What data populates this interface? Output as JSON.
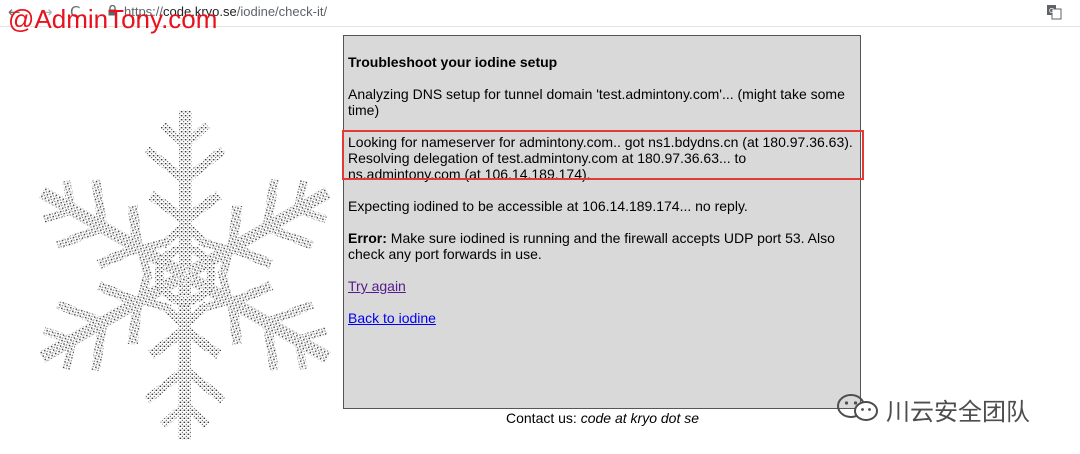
{
  "browser": {
    "back_icon": "←",
    "forward_icon": "→",
    "reload_icon": "C",
    "url_scheme": "https://",
    "url_host": "code.kryo.se",
    "url_path": "/iodine/check-it/"
  },
  "watermark": {
    "top_text": "@AdminTony.com",
    "wechat_text": "川云安全团队",
    "accent": "#e8111d"
  },
  "panel": {
    "title": "Troubleshoot your iodine setup",
    "analyzing": "Analyzing DNS setup for tunnel domain 'test.admintony.com'... (might take some time)",
    "lookup": "Looking for nameserver for admintony.com.. got ns1.bdydns.cn (at 180.97.36.63). Resolving delegation of test.admintony.com at 180.97.36.63... to ns.admintony.com (at 106.14.189.174).",
    "expecting": "Expecting iodined to be accessible at 106.14.189.174... no reply.",
    "error_label": "Error:",
    "error_text": " Make sure iodined is running and the firewall accepts UDP port 53. Also check any port forwards in use.",
    "try_again": "Try again",
    "back_link": "Back to iodine"
  },
  "footer": {
    "contact_label": "Contact us:",
    "contact_value": "code at kryo dot se"
  },
  "colors": {
    "panel_bg": "#d9d9d9",
    "highlight_border": "#e53935",
    "visited_link": "#551a8b",
    "link": "#0000ee"
  }
}
